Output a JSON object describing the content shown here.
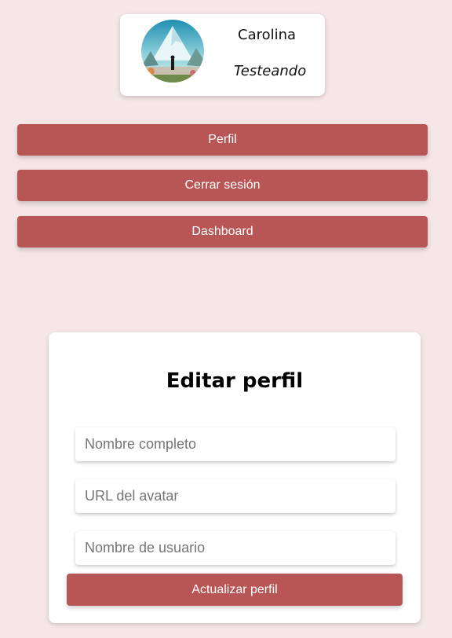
{
  "profile": {
    "name": "Carolina",
    "status": "Testeando",
    "avatar_icon": "mountain-landscape-avatar"
  },
  "nav": {
    "profile_label": "Perfil",
    "logout_label": "Cerrar sesión",
    "dashboard_label": "Dashboard"
  },
  "edit_form": {
    "title": "Editar perfil",
    "full_name_placeholder": "Nombre completo",
    "avatar_url_placeholder": "URL del avatar",
    "username_placeholder": "Nombre de usuario",
    "submit_label": "Actualizar perfil"
  },
  "colors": {
    "background": "#f5e6e7",
    "accent": "#b85656",
    "card": "#ffffff"
  }
}
